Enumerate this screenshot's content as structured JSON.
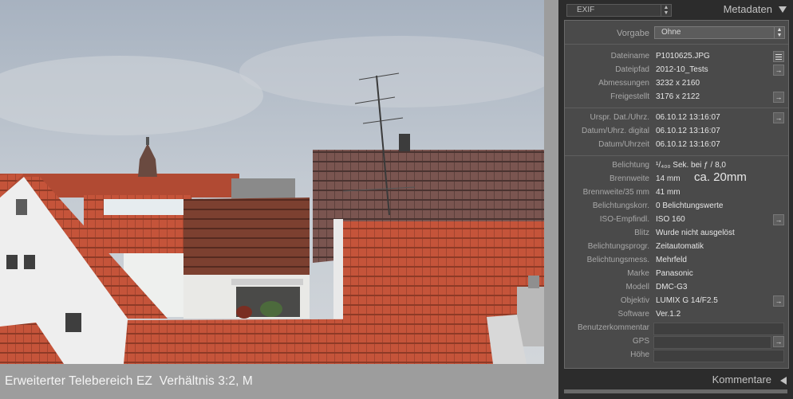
{
  "photo": {
    "caption": "Erweiterter Telebereich EZ  Verhältnis 3:2, M"
  },
  "panel": {
    "preset_dropdown": "EXIF",
    "section_title": "Metadaten",
    "vorgabe_label": "Vorgabe",
    "vorgabe_value": "Ohne",
    "file": [
      {
        "label": "Dateiname",
        "value": "P1010625.JPG"
      },
      {
        "label": "Dateipfad",
        "value": "2012-10_Tests"
      },
      {
        "label": "Abmessungen",
        "value": "3232 x 2160"
      },
      {
        "label": "Freigestellt",
        "value": "3176 x 2122"
      }
    ],
    "dates": [
      {
        "label": "Urspr. Dat./Uhrz.",
        "value": "06.10.12 13:16:07"
      },
      {
        "label": "Datum/Uhrz. digital",
        "value": "06.10.12 13:16:07"
      },
      {
        "label": "Datum/Uhrzeit",
        "value": "06.10.12 13:16:07"
      }
    ],
    "exposure": {
      "label": "Belichtung",
      "value_prefix": "¹/₄₀₀ Sek. bei ƒ / 8,0"
    },
    "focal": {
      "label": "Brennweite",
      "value": "14 mm",
      "annotation": "ca. 20mm"
    },
    "camera": [
      {
        "label": "Brennweite/35 mm",
        "value": "41 mm"
      },
      {
        "label": "Belichtungskorr.",
        "value": "0 Belichtungswerte"
      },
      {
        "label": "ISO-Empfindl.",
        "value": "ISO 160"
      },
      {
        "label": "Blitz",
        "value": "Wurde nicht ausgelöst"
      },
      {
        "label": "Belichtungsprogr.",
        "value": "Zeitautomatik"
      },
      {
        "label": "Belichtungsmess.",
        "value": "Mehrfeld"
      },
      {
        "label": "Marke",
        "value": "Panasonic"
      },
      {
        "label": "Modell",
        "value": "DMC-G3"
      },
      {
        "label": "Objektiv",
        "value": "LUMIX G 14/F2.5"
      },
      {
        "label": "Software",
        "value": "Ver.1.2"
      },
      {
        "label": "Benutzerkommentar",
        "value": ""
      },
      {
        "label": "GPS",
        "value": ""
      },
      {
        "label": "Höhe",
        "value": ""
      }
    ],
    "comments_title": "Kommentare"
  }
}
